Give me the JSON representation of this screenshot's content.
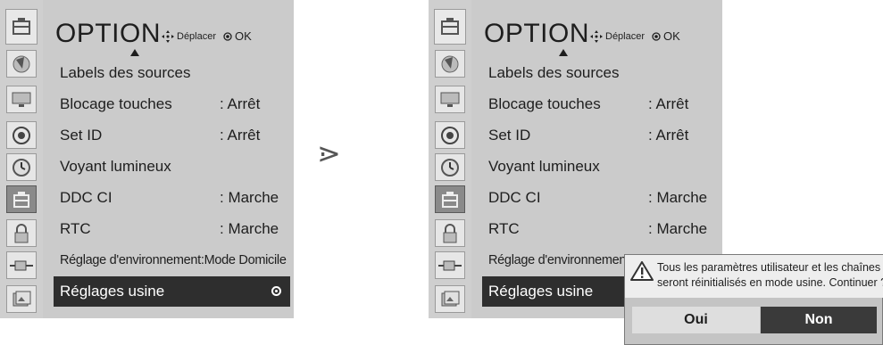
{
  "separator_symbol": "⋗",
  "left_panel": {
    "title": "OPTION",
    "nav_move": "Déplacer",
    "nav_ok": "OK",
    "items": [
      {
        "label": "Labels des sources",
        "value": ""
      },
      {
        "label": "Blocage touches",
        "value": ": Arrêt"
      },
      {
        "label": "Set ID",
        "value": ": Arrêt"
      },
      {
        "label": "Voyant lumineux",
        "value": ""
      },
      {
        "label": "DDC CI",
        "value": ": Marche"
      },
      {
        "label": "RTC",
        "value": ": Marche"
      },
      {
        "label": "Réglage d'environnement:Mode Domicile",
        "value": ""
      },
      {
        "label": "Réglages usine",
        "value": ""
      }
    ],
    "selected_index": 7
  },
  "right_panel": {
    "title": "OPTION",
    "nav_move": "Déplacer",
    "nav_ok": "OK",
    "items": [
      {
        "label": "Labels des sources",
        "value": ""
      },
      {
        "label": "Blocage touches",
        "value": ": Arrêt"
      },
      {
        "label": "Set ID",
        "value": ": Arrêt"
      },
      {
        "label": "Voyant lumineux",
        "value": ""
      },
      {
        "label": "DDC CI",
        "value": ": Marche"
      },
      {
        "label": "RTC",
        "value": ": Marche"
      },
      {
        "label": "Réglage d'environnement:Mode Domicile",
        "value": ""
      },
      {
        "label": "Réglages usine",
        "value": ""
      }
    ],
    "selected_index": 7
  },
  "dialog": {
    "message_line1": "Tous les paramètres utilisateur et les chaînes",
    "message_line2": "seront réinitialisés en mode usine. Continuer ?",
    "yes_label": "Oui",
    "no_label": "Non",
    "icon": "warning-icon"
  },
  "sidebar_icons": [
    "option-menu-icon",
    "picture-icon",
    "screen-icon",
    "audio-icon",
    "time-icon",
    "option-icon",
    "lock-icon",
    "input-icon",
    "usb-photo-icon"
  ],
  "colors": {
    "panel_bg": "#cbcbcb",
    "selected_bg": "#2e2e2e",
    "dialog_no_bg": "#3a3a3a"
  }
}
